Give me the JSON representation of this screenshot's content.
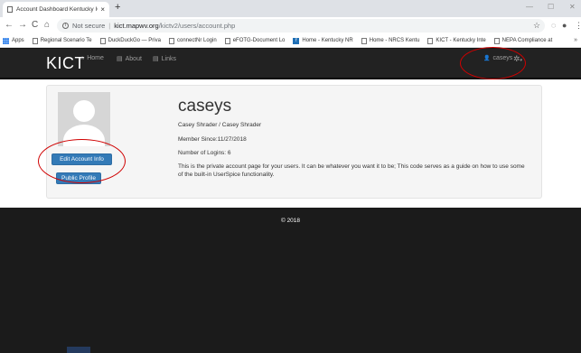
{
  "browser": {
    "tab_title": "Account Dashboard Kentucky IC",
    "tab_close": "×",
    "new_tab": "+",
    "window_controls": [
      "—",
      "☐",
      "✕"
    ],
    "nav": {
      "back": "←",
      "forward": "→",
      "reload": "C",
      "home": "⌂"
    },
    "address": {
      "security": "Not secure",
      "separator": "|",
      "host": "kict.mapwv.org",
      "path": "/kictv2/users/account.php"
    },
    "toolbar_icons": {
      "star": "☆",
      "extension": "◌",
      "account": "●",
      "menu": "⋮"
    },
    "bookmarks": [
      {
        "label": "Apps",
        "icon": "apps"
      },
      {
        "label": "Regional Scenario Te",
        "icon": "page"
      },
      {
        "label": "DuckDuckGo — Priva",
        "icon": "page"
      },
      {
        "label": "connectNr Login",
        "icon": "page"
      },
      {
        "label": "eFOTG-Document Lo",
        "icon": "page"
      },
      {
        "label": "Home - Kentucky NR",
        "icon": "f"
      },
      {
        "label": "Home - NRCS Kentu",
        "icon": "page"
      },
      {
        "label": "KICT - Kentucky Inte",
        "icon": "page"
      },
      {
        "label": "NEPA Compliance at",
        "icon": "page"
      }
    ],
    "bookmarks_more": "»"
  },
  "site": {
    "brand": "KICT",
    "nav_links": [
      {
        "label": "Home",
        "icon": "⌂"
      },
      {
        "label": "About",
        "icon": "▤"
      },
      {
        "label": "Links",
        "icon": "▤"
      }
    ],
    "user_menu": {
      "icon": "👤",
      "label": "caseys"
    },
    "settings": {
      "icon": "✲",
      "caret": "▾"
    }
  },
  "account": {
    "username": "caseys",
    "full_name": "Casey Shrader / Casey Shrader",
    "member_since": "Member Since:11/27/2018",
    "logins": "Number of Logins: 6",
    "description": "This is the private account page for your users. It can be whatever you want it to be; This code serves as a guide on how to use some of the built-in UserSpice functionality.",
    "edit_button": "Edit Account Info",
    "public_button": "Public Profile"
  },
  "footer": {
    "copyright": "© 2018"
  },
  "colors": {
    "navbar": "#222222",
    "footer": "#1b1b1b",
    "button": "#337ab7",
    "annotation": "#d00000"
  }
}
